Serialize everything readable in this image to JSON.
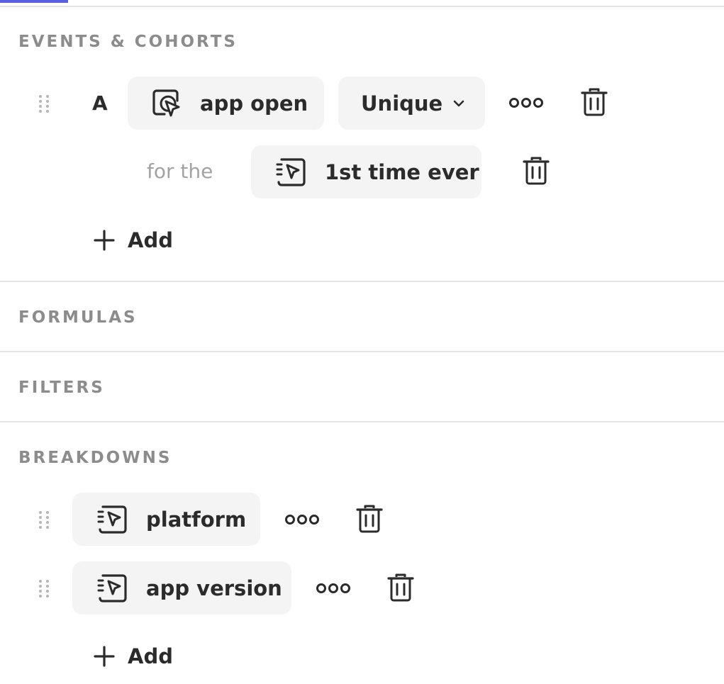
{
  "sections": {
    "events": {
      "title": "EVENTS & COHORTS",
      "rows": [
        {
          "letter": "A",
          "event": {
            "label": "app open",
            "icon": "cursor-select-icon"
          },
          "aggregation": {
            "label": "Unique",
            "icon": "chevron-down-icon"
          },
          "more_icon": "more-options-icon",
          "delete_icon": "trash-icon",
          "modifier": {
            "prefix": "for the",
            "value": {
              "label": "1st time ever",
              "icon": "property-cursor-icon"
            },
            "delete_icon": "trash-icon"
          }
        }
      ],
      "add_label": "Add"
    },
    "formulas": {
      "title": "FORMULAS"
    },
    "filters": {
      "title": "FILTERS"
    },
    "breakdowns": {
      "title": "BREAKDOWNS",
      "items": [
        {
          "label": "platform",
          "icon": "property-cursor-icon"
        },
        {
          "label": "app version",
          "icon": "property-cursor-icon"
        }
      ],
      "add_label": "Add"
    }
  },
  "colors": {
    "accent": "#5b5fe0",
    "pill_background": "#f4f4f4",
    "section_title": "#8c8c8c",
    "muted_text": "#a3a3a3",
    "divider": "#e4e4e4"
  }
}
